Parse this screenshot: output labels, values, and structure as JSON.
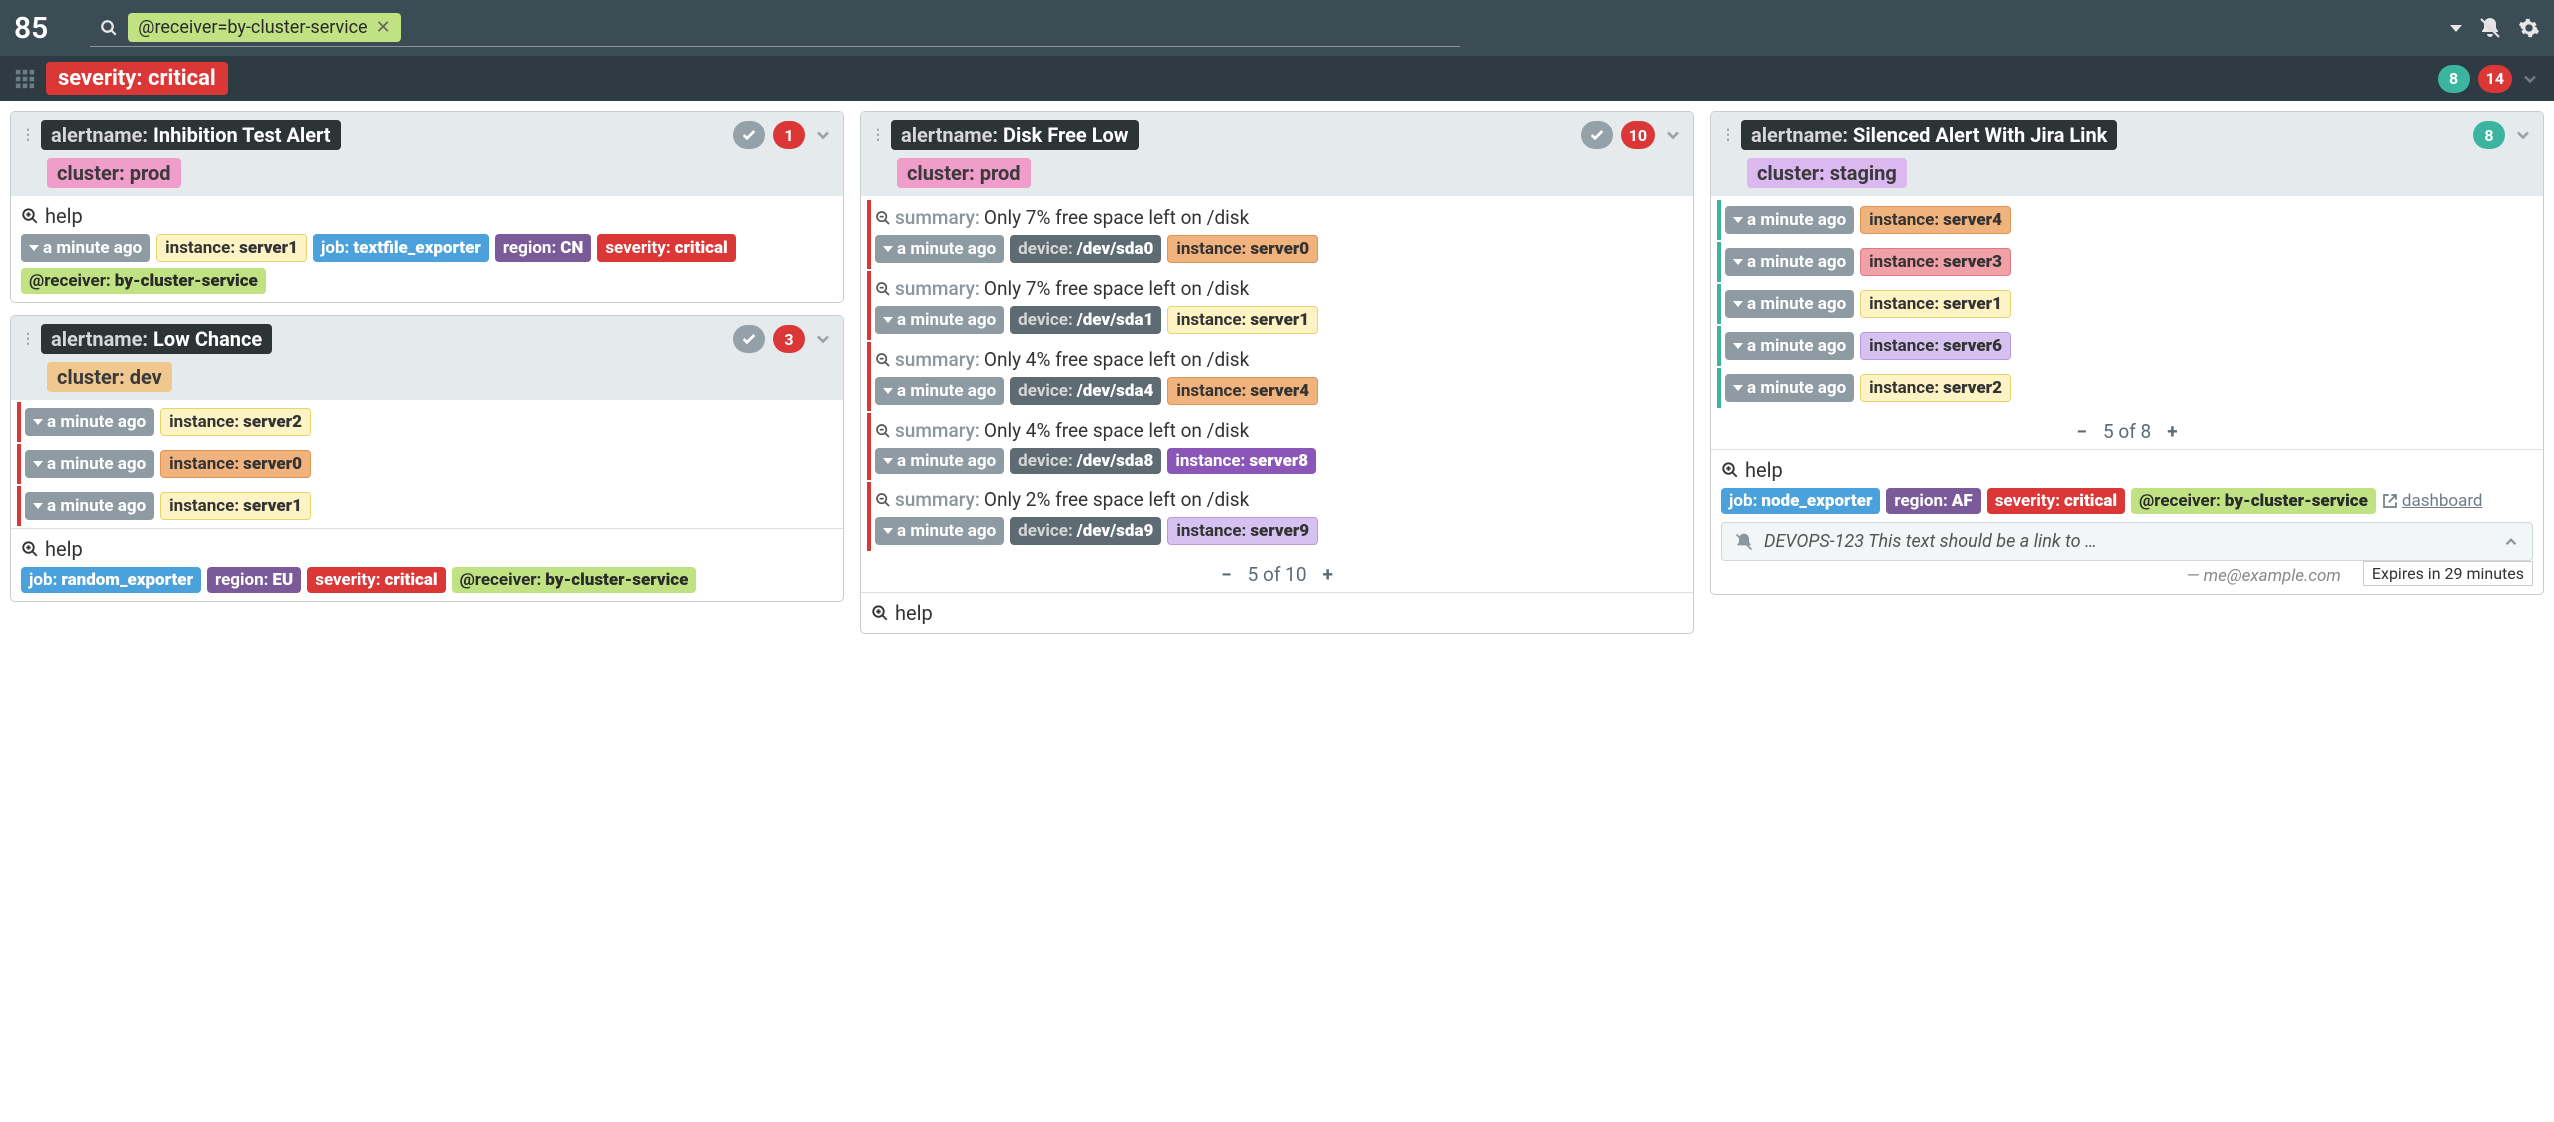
{
  "topnav": {
    "total_alerts": "85",
    "filter": {
      "text": "@receiver=by-cluster-service"
    }
  },
  "filterbar": {
    "label_key": "severity:",
    "label_val": "critical",
    "silenced_count": "8",
    "active_count": "14"
  },
  "cards": {
    "inhibition": {
      "title_key": "alertname:",
      "title_val": "Inhibition Test Alert",
      "count": "1",
      "cluster_key": "cluster:",
      "cluster_val": "prod",
      "help": "help",
      "time": "a minute ago",
      "instance_key": "instance:",
      "instance_val": "server1",
      "job_key": "job:",
      "job_val": "textfile_exporter",
      "region_key": "region:",
      "region_val": "CN",
      "severity_key": "severity:",
      "severity_val": "critical",
      "receiver_key": "@receiver:",
      "receiver_val": "by-cluster-service"
    },
    "lowchance": {
      "title_key": "alertname:",
      "title_val": "Low Chance",
      "count": "3",
      "cluster_key": "cluster:",
      "cluster_val": "dev",
      "items": [
        {
          "time": "a minute ago",
          "instance": "server2"
        },
        {
          "time": "a minute ago",
          "instance": "server0"
        },
        {
          "time": "a minute ago",
          "instance": "server1"
        }
      ],
      "help": "help",
      "job_key": "job:",
      "job_val": "random_exporter",
      "region_key": "region:",
      "region_val": "EU",
      "severity_key": "severity:",
      "severity_val": "critical",
      "receiver_key": "@receiver:",
      "receiver_val": "by-cluster-service"
    },
    "diskfree": {
      "title_key": "alertname:",
      "title_val": "Disk Free Low",
      "count": "10",
      "cluster_key": "cluster:",
      "cluster_val": "prod",
      "items": [
        {
          "summary_key": "summary:",
          "summary": "Only 7% free space left on /disk",
          "time": "a minute ago",
          "device_key": "device:",
          "device": "/dev/sda0",
          "instance_key": "instance:",
          "instance": "server0",
          "iclass": "orange"
        },
        {
          "summary_key": "summary:",
          "summary": "Only 7% free space left on /disk",
          "time": "a minute ago",
          "device_key": "device:",
          "device": "/dev/sda1",
          "instance_key": "instance:",
          "instance": "server1",
          "iclass": "yellow"
        },
        {
          "summary_key": "summary:",
          "summary": "Only 4% free space left on /disk",
          "time": "a minute ago",
          "device_key": "device:",
          "device": "/dev/sda4",
          "instance_key": "instance:",
          "instance": "server4",
          "iclass": "orange"
        },
        {
          "summary_key": "summary:",
          "summary": "Only 4% free space left on /disk",
          "time": "a minute ago",
          "device_key": "device:",
          "device": "/dev/sda8",
          "instance_key": "instance:",
          "instance": "server8",
          "iclass": "purple2"
        },
        {
          "summary_key": "summary:",
          "summary": "Only 2% free space left on /disk",
          "time": "a minute ago",
          "device_key": "device:",
          "device": "/dev/sda9",
          "instance_key": "instance:",
          "instance": "server9",
          "iclass": "lav"
        }
      ],
      "pager": "5 of 10",
      "help": "help"
    },
    "silenced": {
      "title_key": "alertname:",
      "title_val": "Silenced Alert With Jira Link",
      "count": "8",
      "cluster_key": "cluster:",
      "cluster_val": "staging",
      "items": [
        {
          "time": "a minute ago",
          "instance_key": "instance:",
          "instance": "server4",
          "iclass": "orange"
        },
        {
          "time": "a minute ago",
          "instance_key": "instance:",
          "instance": "server3",
          "iclass": "pink"
        },
        {
          "time": "a minute ago",
          "instance_key": "instance:",
          "instance": "server1",
          "iclass": "yellow"
        },
        {
          "time": "a minute ago",
          "instance_key": "instance:",
          "instance": "server6",
          "iclass": "lav"
        },
        {
          "time": "a minute ago",
          "instance_key": "instance:",
          "instance": "server2",
          "iclass": "yellow"
        }
      ],
      "pager": "5 of 8",
      "help": "help",
      "job_key": "job:",
      "job_val": "node_exporter",
      "region_key": "region:",
      "region_val": "AF",
      "severity_key": "severity:",
      "severity_val": "critical",
      "receiver_key": "@receiver:",
      "receiver_val": "by-cluster-service",
      "dashboard": "dashboard",
      "silence_text": "DEVOPS-123 This text should be a link to …",
      "silence_author": "— me@example.com",
      "silence_expire": "Expires in 29 minutes"
    }
  },
  "labels": {
    "instance": "instance:"
  }
}
